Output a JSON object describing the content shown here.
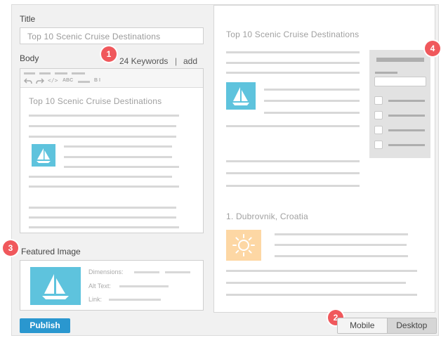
{
  "editor": {
    "title_label": "Title",
    "title_value": "Top 10 Scenic Cruise Destinations",
    "body_label": "Body",
    "keywords": "24 Keywords",
    "keywords_sep": "|",
    "add_link": "add",
    "body_heading": "Top 10 Scenic Cruise Destinations",
    "toolbar_icons": [
      "undo-icon",
      "redo-icon",
      "code-icon",
      "spellcheck-icon",
      "bold-icon",
      "italic-icon"
    ],
    "toolbar_text": {
      "code": "</>",
      "abc": "ABC",
      "bi": "B I"
    }
  },
  "featured": {
    "label": "Featured Image",
    "dimensions_label": "Dimensions:",
    "alt_label": "Alt Text:",
    "link_label": "Link:"
  },
  "preview": {
    "heading": "Top 10 Scenic Cruise Destinations",
    "section_heading": "1. Dubrovnik, Croatia"
  },
  "actions": {
    "publish": "Publish",
    "mobile": "Mobile",
    "desktop": "Desktop",
    "active_view": "Desktop"
  },
  "badges": [
    "1",
    "2",
    "3",
    "4"
  ],
  "colors": {
    "accent": "#2a97cf",
    "badge": "#f0585c",
    "thumbnail_blue": "#5ec3dd",
    "thumbnail_orange": "#fdd7a4"
  }
}
